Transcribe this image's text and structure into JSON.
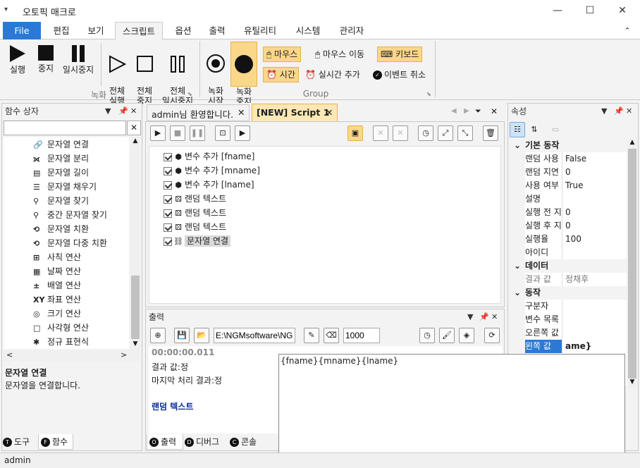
{
  "app": {
    "title": "오토픽 매크로",
    "qa_icon": "▾"
  },
  "window_controls": {
    "minimize": "—",
    "maximize": "☐",
    "close": "✕"
  },
  "menu": {
    "file": "File",
    "tabs": [
      "편집",
      "보기",
      "스크립트",
      "옵션",
      "출력",
      "유틸리티",
      "시스템",
      "관리자"
    ],
    "collapse": "⌃"
  },
  "ribbon": {
    "record_group": {
      "label": "녹화",
      "run": "실행",
      "stop": "중지",
      "pause": "일시중지",
      "run_all": "전체\n실행",
      "stop_all": "전체\n중지",
      "pause_all": "전체\n일시중지"
    },
    "group2": {
      "label": "Group",
      "rec_start": "녹화\n시작",
      "rec_stop": "녹화\n중지",
      "mouse": "마우스",
      "mouse_move": "마우스 이동",
      "keyboard": "키보드",
      "time": "시간",
      "realtime_add": "실시간 추가",
      "event_cancel": "이벤트 취소"
    }
  },
  "function_box": {
    "title": "함수 상자",
    "search_value": "",
    "items": [
      {
        "icon": "link-icon",
        "label": "문자열 연결",
        "glyph": "🔗"
      },
      {
        "icon": "split-icon",
        "label": "문자열 분리",
        "glyph": "⟗"
      },
      {
        "icon": "length-icon",
        "label": "문자열 길이",
        "glyph": "▤"
      },
      {
        "icon": "fill-icon",
        "label": "문자열 채우기",
        "glyph": "☰"
      },
      {
        "icon": "search-icon",
        "label": "문자열 찾기",
        "glyph": "⚲"
      },
      {
        "icon": "search-middle-icon",
        "label": "중간 문자열 찾기",
        "glyph": "⚲"
      },
      {
        "icon": "replace-icon",
        "label": "문자열 치환",
        "glyph": "⟲"
      },
      {
        "icon": "multi-replace-icon",
        "label": "문자열 다중 치환",
        "glyph": "⟲"
      },
      {
        "icon": "arithmetic-icon",
        "label": "사칙 연산",
        "glyph": "⊞"
      },
      {
        "icon": "calendar-icon",
        "label": "날짜 연산",
        "glyph": "▦"
      },
      {
        "icon": "plus-minus-icon",
        "label": "배열 연산",
        "glyph": "±"
      },
      {
        "icon": "xy-icon",
        "label": "좌표 연산",
        "glyph": "XY"
      },
      {
        "icon": "size-icon",
        "label": "크기 연산",
        "glyph": "◎"
      },
      {
        "icon": "rectangle-icon",
        "label": "사각형 연산",
        "glyph": "□"
      },
      {
        "icon": "asterisk-icon",
        "label": "정규 표현식",
        "glyph": "✱"
      }
    ],
    "desc_title": "문자열 연결",
    "desc_text": "문자열을 연결합니다.",
    "bottom_tabs": [
      {
        "badge": "T",
        "label": "도구"
      },
      {
        "badge": "F",
        "label": "함수"
      }
    ]
  },
  "doc_tabs": [
    {
      "label": "admin님 환영합니다.",
      "close": "✕"
    },
    {
      "label": "[NEW] Script 1",
      "close": "✕"
    }
  ],
  "script_items": [
    {
      "icon": "cube-icon",
      "label": "변수 추가 [fname]"
    },
    {
      "icon": "cube-icon",
      "label": "변수 추가 [mname]"
    },
    {
      "icon": "cube-icon",
      "label": "변수 추가 [lname]"
    },
    {
      "icon": "dice-icon",
      "label": "랜덤 텍스트"
    },
    {
      "icon": "dice-icon",
      "label": "랜덤 텍스트"
    },
    {
      "icon": "dice-icon",
      "label": "랜덤 텍스트"
    },
    {
      "icon": "link-icon",
      "label": "문자열 연결"
    }
  ],
  "output": {
    "title": "출력",
    "path": "E:\\NGMsoftware\\NG",
    "count": "1000",
    "timestamp": "00:00:00.011",
    "line1": "결과 값:정",
    "line2": "마지막 처리 결과:정",
    "section": "랜덤 텍스트",
    "bottom_tabs": [
      {
        "badge": "O",
        "label": "출력"
      },
      {
        "badge": "D",
        "label": "디버그"
      },
      {
        "badge": "C",
        "label": "콘솔"
      }
    ]
  },
  "properties": {
    "title": "속성",
    "cat_basic": "기본 동작",
    "rows_basic": [
      {
        "k": "랜덤 사용",
        "v": "False"
      },
      {
        "k": "랜덤 지연",
        "v": "0"
      },
      {
        "k": "사용 여부",
        "v": "True"
      },
      {
        "k": "설명",
        "v": ""
      },
      {
        "k": "실행 전 지",
        "v": "0"
      },
      {
        "k": "실행 후 지",
        "v": "0"
      },
      {
        "k": "실행율",
        "v": "100"
      },
      {
        "k": "아이디",
        "v": ""
      }
    ],
    "cat_data": "데이터",
    "rows_data": [
      {
        "k": "결과 값",
        "v": "정채후"
      }
    ],
    "cat_action": "동작",
    "rows_action": [
      {
        "k": "구분자",
        "v": ""
      },
      {
        "k": "변수 목록",
        "v": ""
      },
      {
        "k": "오른쪽 값",
        "v": ""
      },
      {
        "k": "왼쪽 값",
        "v": "ame}{lname}"
      }
    ]
  },
  "editor_popup": {
    "text": "{fname}{mname}{lname}"
  },
  "status": {
    "user": "admin"
  }
}
